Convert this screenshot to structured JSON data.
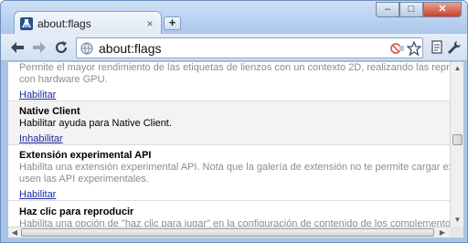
{
  "tab": {
    "title": "about:flags",
    "favicon_icon": "flask-icon",
    "close_glyph": "×"
  },
  "new_tab_glyph": "+",
  "window_controls": {
    "minimize_glyph": "–",
    "maximize_glyph": "□",
    "close_glyph": "✕"
  },
  "toolbar": {
    "back_icon": "back-arrow-icon",
    "forward_icon": "forward-arrow-icon",
    "reload_icon": "reload-icon",
    "bookmark_icon": "star-icon",
    "settings_icon": "wrench-icon",
    "page_action_icon": "sandbox-page-icon"
  },
  "omnibox": {
    "value": "about:flags"
  },
  "experiments": [
    {
      "title": "",
      "description_line1": "Permite el mayor rendimiento de las etiquetas de lienzos con un contexto 2D, realizando las representaciones",
      "description_line2": "con hardware GPU.",
      "link": "Habilitar",
      "enabled": false
    },
    {
      "title": "Native Client",
      "description_line1": "Habilitar ayuda para Native Client.",
      "description_line2": "",
      "link": "Inhabilitar",
      "enabled": true
    },
    {
      "title": "Extensión experimental API",
      "description_line1": "Habilita una extensión experimental API. Nota que la galería de extensión no te permite cargar extensiones que",
      "description_line2": "usen las API experimentales.",
      "link": "Habilitar",
      "enabled": false
    },
    {
      "title": "Haz clic para reproducir",
      "description_line1": "Habilita una opción de \"haz clic para jugar\" en la configuración de contenido de los complementos.",
      "description_line2": "",
      "link": "",
      "enabled": false
    }
  ],
  "colors": {
    "link": "#1b2c9c",
    "enabled_row_bg": "#f3f3f3",
    "disabled_text": "#8c8c8c",
    "frame": "#a9c4e6"
  }
}
